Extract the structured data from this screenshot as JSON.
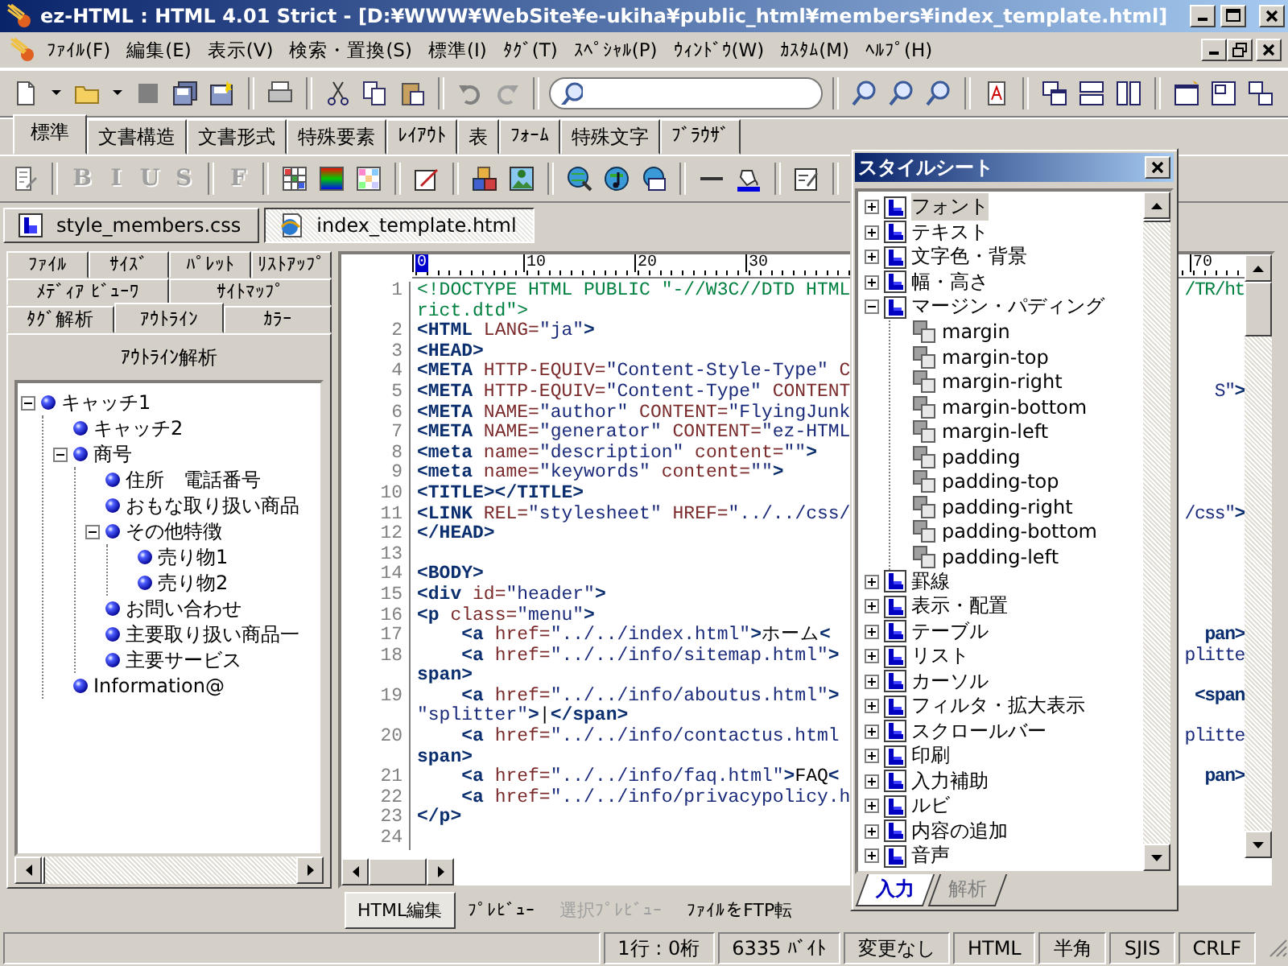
{
  "window": {
    "title": "ez-HTML : HTML 4.01 Strict - [D:¥WWW¥WebSite¥e-ukiha¥public_html¥members¥index_template.html]"
  },
  "menu": [
    "ﾌｧｲﾙ(F)",
    "編集(E)",
    "表示(V)",
    "検索・置換(S)",
    "標準(I)",
    "ﾀｸﾞ(T)",
    "ｽﾍﾟｼｬﾙ(P)",
    "ｳｨﾝﾄﾞｳ(W)",
    "ｶｽﾀﾑ(M)",
    "ﾍﾙﾌﾟ(H)"
  ],
  "toolbar_tabs": [
    {
      "label": "標準",
      "selected": true
    },
    {
      "label": "文書構造",
      "selected": false
    },
    {
      "label": "文書形式",
      "selected": false
    },
    {
      "label": "特殊要素",
      "selected": false
    },
    {
      "label": "ﾚｲｱｳﾄ",
      "selected": false
    },
    {
      "label": "表",
      "selected": false
    },
    {
      "label": "ﾌｫｰﾑ",
      "selected": false
    },
    {
      "label": "特殊文字",
      "selected": false
    },
    {
      "label": "ﾌﾞﾗｳｻﾞ",
      "selected": false
    }
  ],
  "format_buttons": [
    {
      "label": "B",
      "disabled": true
    },
    {
      "label": "I",
      "disabled": true
    },
    {
      "label": "U",
      "disabled": true
    },
    {
      "label": "S",
      "disabled": true
    },
    {
      "label": "F",
      "disabled": true
    }
  ],
  "documents": [
    {
      "name": "style_members.css",
      "kind": "css",
      "selected": false
    },
    {
      "name": "index_template.html",
      "kind": "html",
      "selected": true
    }
  ],
  "side_tabs": [
    {
      "tabs": [
        {
          "label": "ﾌｧｲﾙ",
          "selected": false
        },
        {
          "label": "ｻｲｽﾞ",
          "selected": false
        },
        {
          "label": "ﾊﾟﾚｯﾄ",
          "selected": false
        },
        {
          "label": "ﾘｽﾄｱｯﾌﾟ",
          "selected": false
        }
      ]
    },
    {
      "tabs": [
        {
          "label": "ﾒﾃﾞｨｱ ﾋﾞｭｰﾜ",
          "selected": false
        },
        {
          "label": "ｻｲﾄﾏｯﾌﾟ",
          "selected": false
        }
      ]
    },
    {
      "tabs": [
        {
          "label": "ﾀｸﾞ解析",
          "selected": false
        },
        {
          "label": "ｱｳﾄﾗｲﾝ",
          "selected": true
        },
        {
          "label": "ｶﾗｰ",
          "selected": false
        }
      ]
    }
  ],
  "outline": {
    "title": "ｱｳﾄﾗｲﾝ解析",
    "items": [
      {
        "label": "キャッチ1",
        "expanded": true,
        "children": [
          {
            "label": "キャッチ2"
          },
          {
            "label": "商号",
            "expanded": true,
            "children": [
              {
                "label": "住所　電話番号"
              },
              {
                "label": "おもな取り扱い商品"
              },
              {
                "label": "その他特徴",
                "expanded": true,
                "children": [
                  {
                    "label": "売り物1"
                  },
                  {
                    "label": "売り物2"
                  }
                ]
              },
              {
                "label": "お問い合わせ"
              },
              {
                "label": "主要取り扱い商品一"
              },
              {
                "label": "主要サービス"
              }
            ]
          },
          {
            "label": "Information@"
          }
        ]
      }
    ]
  },
  "editor": {
    "ruler": [
      "0",
      "10",
      "20",
      "30"
    ],
    "ruler_tail": "70",
    "lines": [
      {
        "number": "1",
        "segments": [
          {
            "kind": "doctype",
            "text": "<!DOCTYPE HTML PUBLIC \"-//W3C//DTD HTML"
          }
        ],
        "tail": [
          {
            "kind": "doctype",
            "text": "/TR/ht"
          }
        ]
      },
      {
        "segments": [
          {
            "kind": "doctype",
            "text": "rict.dtd\">"
          }
        ]
      },
      {
        "number": "2",
        "segments": [
          {
            "kind": "tag",
            "text": "<HTML"
          },
          {
            "kind": "attr",
            "text": " LANG="
          },
          {
            "kind": "value",
            "text": "\"ja\""
          },
          {
            "kind": "tag",
            "text": ">"
          }
        ]
      },
      {
        "number": "3",
        "segments": [
          {
            "kind": "tag",
            "text": "<HEAD>"
          }
        ]
      },
      {
        "number": "4",
        "segments": [
          {
            "kind": "tag",
            "text": "<META"
          },
          {
            "kind": "attr",
            "text": " HTTP-EQUIV="
          },
          {
            "kind": "value",
            "text": "\"Content-Style-Type\""
          },
          {
            "kind": "attr",
            "text": " C"
          }
        ]
      },
      {
        "number": "5",
        "segments": [
          {
            "kind": "tag",
            "text": "<META"
          },
          {
            "kind": "attr",
            "text": " HTTP-EQUIV="
          },
          {
            "kind": "value",
            "text": "\"Content-Type\""
          },
          {
            "kind": "attr",
            "text": " CONTENT"
          }
        ],
        "tail": [
          {
            "kind": "value",
            "text": "S\""
          },
          {
            "kind": "tag",
            "text": ">"
          }
        ]
      },
      {
        "number": "6",
        "segments": [
          {
            "kind": "tag",
            "text": "<META"
          },
          {
            "kind": "attr",
            "text": " NAME="
          },
          {
            "kind": "value",
            "text": "\"author\""
          },
          {
            "kind": "attr",
            "text": " CONTENT="
          },
          {
            "kind": "value",
            "text": "\"FlyingJunk"
          }
        ]
      },
      {
        "number": "7",
        "segments": [
          {
            "kind": "tag",
            "text": "<META"
          },
          {
            "kind": "attr",
            "text": " NAME="
          },
          {
            "kind": "value",
            "text": "\"generator\""
          },
          {
            "kind": "attr",
            "text": " CONTENT="
          },
          {
            "kind": "value",
            "text": "\"ez-HTML"
          }
        ]
      },
      {
        "number": "8",
        "segments": [
          {
            "kind": "tag",
            "text": "<meta"
          },
          {
            "kind": "attr",
            "text": " name="
          },
          {
            "kind": "value",
            "text": "\"description\""
          },
          {
            "kind": "attr",
            "text": " content="
          },
          {
            "kind": "value",
            "text": "\"\""
          },
          {
            "kind": "tag",
            "text": ">"
          }
        ]
      },
      {
        "number": "9",
        "segments": [
          {
            "kind": "tag",
            "text": "<meta"
          },
          {
            "kind": "attr",
            "text": " name="
          },
          {
            "kind": "value",
            "text": "\"keywords\""
          },
          {
            "kind": "attr",
            "text": " content="
          },
          {
            "kind": "value",
            "text": "\"\""
          },
          {
            "kind": "tag",
            "text": ">"
          }
        ]
      },
      {
        "number": "10",
        "segments": [
          {
            "kind": "tag",
            "text": "<TITLE></TITLE>"
          }
        ]
      },
      {
        "number": "11",
        "segments": [
          {
            "kind": "tag",
            "text": "<LINK"
          },
          {
            "kind": "attr",
            "text": " REL="
          },
          {
            "kind": "value",
            "text": "\"stylesheet\""
          },
          {
            "kind": "attr",
            "text": " HREF="
          },
          {
            "kind": "value",
            "text": "\"../../css/"
          }
        ],
        "tail": [
          {
            "kind": "value",
            "text": "/css\""
          },
          {
            "kind": "tag",
            "text": ">"
          }
        ]
      },
      {
        "number": "12",
        "segments": [
          {
            "kind": "tag",
            "text": "</HEAD>"
          }
        ]
      },
      {
        "number": "13"
      },
      {
        "number": "14",
        "segments": [
          {
            "kind": "tag",
            "text": "<BODY>"
          }
        ]
      },
      {
        "number": "15",
        "segments": [
          {
            "kind": "tag",
            "text": "<div"
          },
          {
            "kind": "attr",
            "text": " id="
          },
          {
            "kind": "value",
            "text": "\"header\""
          },
          {
            "kind": "tag",
            "text": ">"
          }
        ]
      },
      {
        "number": "16",
        "segments": [
          {
            "kind": "tag",
            "text": "<p"
          },
          {
            "kind": "attr",
            "text": " class="
          },
          {
            "kind": "value",
            "text": "\"menu\""
          },
          {
            "kind": "tag",
            "text": ">"
          }
        ]
      },
      {
        "number": "17",
        "segments": [
          {
            "kind": "tag",
            "text": "    <a"
          },
          {
            "kind": "attr",
            "text": " href="
          },
          {
            "kind": "value",
            "text": "\"../../index.html\""
          },
          {
            "kind": "tag",
            "text": ">"
          },
          {
            "kind": "text",
            "text": "ホーム"
          },
          {
            "kind": "tag",
            "text": "<"
          }
        ],
        "tail": [
          {
            "kind": "tag",
            "text": "pan>"
          }
        ]
      },
      {
        "number": "18",
        "segments": [
          {
            "kind": "tag",
            "text": "    <a"
          },
          {
            "kind": "attr",
            "text": " href="
          },
          {
            "kind": "value",
            "text": "\"../../info/sitemap.html\""
          },
          {
            "kind": "tag",
            "text": ">"
          }
        ],
        "tail": [
          {
            "kind": "value",
            "text": "plitte"
          }
        ]
      },
      {
        "segments": [
          {
            "kind": "tag",
            "text": "span>"
          }
        ]
      },
      {
        "number": "19",
        "segments": [
          {
            "kind": "tag",
            "text": "    <a"
          },
          {
            "kind": "attr",
            "text": " href="
          },
          {
            "kind": "value",
            "text": "\"../../info/aboutus.html\""
          },
          {
            "kind": "tag",
            "text": ">"
          }
        ],
        "tail": [
          {
            "kind": "tag",
            "text": "<span"
          }
        ]
      },
      {
        "segments": [
          {
            "kind": "value",
            "text": "\"splitter\""
          },
          {
            "kind": "tag",
            "text": ">"
          },
          {
            "kind": "text",
            "text": "|"
          },
          {
            "kind": "tag",
            "text": "</span>"
          }
        ]
      },
      {
        "number": "20",
        "segments": [
          {
            "kind": "tag",
            "text": "    <a"
          },
          {
            "kind": "attr",
            "text": " href="
          },
          {
            "kind": "value",
            "text": "\"../../info/contactus.html"
          }
        ],
        "tail": [
          {
            "kind": "value",
            "text": "plitte"
          }
        ]
      },
      {
        "segments": [
          {
            "kind": "tag",
            "text": "span>"
          }
        ]
      },
      {
        "number": "21",
        "segments": [
          {
            "kind": "tag",
            "text": "    <a"
          },
          {
            "kind": "attr",
            "text": " href="
          },
          {
            "kind": "value",
            "text": "\"../../info/faq.html\""
          },
          {
            "kind": "tag",
            "text": ">"
          },
          {
            "kind": "text",
            "text": "FAQ"
          },
          {
            "kind": "tag",
            "text": "<"
          }
        ],
        "tail": [
          {
            "kind": "tag",
            "text": "pan>"
          }
        ]
      },
      {
        "number": "22",
        "segments": [
          {
            "kind": "tag",
            "text": "    <a"
          },
          {
            "kind": "attr",
            "text": " href="
          },
          {
            "kind": "value",
            "text": "\"../../info/privacypolicy.h"
          }
        ]
      },
      {
        "number": "23",
        "segments": [
          {
            "kind": "tag",
            "text": "</p>"
          }
        ]
      },
      {
        "number": "24"
      }
    ]
  },
  "editor_tabs": [
    {
      "label": "HTML編集",
      "selected": true,
      "disabled": false
    },
    {
      "label": "ﾌﾟﾚﾋﾞｭｰ",
      "selected": false,
      "disabled": false
    },
    {
      "label": "選択ﾌﾟﾚﾋﾞｭｰ",
      "selected": false,
      "disabled": true
    },
    {
      "label": "ﾌｧｲﾙをFTP転",
      "selected": false,
      "disabled": false
    }
  ],
  "status_bar": [
    "1行 : 0桁",
    "6335 ﾊﾞｲﾄ",
    "変更なし",
    "HTML",
    "半角",
    "SJIS",
    "CRLF"
  ],
  "stylesheet": {
    "title": "スタイルシート",
    "items": [
      {
        "label": "フォント",
        "selected": true,
        "expanded": false
      },
      {
        "label": "テキスト",
        "selected": false,
        "expanded": false
      },
      {
        "label": "文字色・背景",
        "selected": false,
        "expanded": false
      },
      {
        "label": "幅・高さ",
        "selected": false,
        "expanded": false
      },
      {
        "label": "マージン・パディング",
        "selected": false,
        "expanded": true,
        "children": [
          {
            "label": "margin",
            "selected": false
          },
          {
            "label": "margin-top",
            "selected": false
          },
          {
            "label": "margin-right",
            "selected": false
          },
          {
            "label": "margin-bottom",
            "selected": false
          },
          {
            "label": "margin-left",
            "selected": false
          },
          {
            "label": "padding",
            "selected": false
          },
          {
            "label": "padding-top",
            "selected": false
          },
          {
            "label": "padding-right",
            "selected": false
          },
          {
            "label": "padding-bottom",
            "selected": false
          },
          {
            "label": "padding-left",
            "selected": false
          }
        ]
      },
      {
        "label": "罫線",
        "selected": false,
        "expanded": false
      },
      {
        "label": "表示・配置",
        "selected": false,
        "expanded": false
      },
      {
        "label": "テーブル",
        "selected": false,
        "expanded": false
      },
      {
        "label": "リスト",
        "selected": false,
        "expanded": false
      },
      {
        "label": "カーソル",
        "selected": false,
        "expanded": false
      },
      {
        "label": "フィルタ・拡大表示",
        "selected": false,
        "expanded": false
      },
      {
        "label": "スクロールバー",
        "selected": false,
        "expanded": false
      },
      {
        "label": "印刷",
        "selected": false,
        "expanded": false
      },
      {
        "label": "入力補助",
        "selected": false,
        "expanded": false
      },
      {
        "label": "ルビ",
        "selected": false,
        "expanded": false
      },
      {
        "label": "内容の追加",
        "selected": false,
        "expanded": false
      },
      {
        "label": "音声",
        "selected": false,
        "expanded": false
      }
    ],
    "tabs": [
      {
        "label": "入力",
        "selected": true
      },
      {
        "label": "解析",
        "selected": false
      }
    ]
  }
}
